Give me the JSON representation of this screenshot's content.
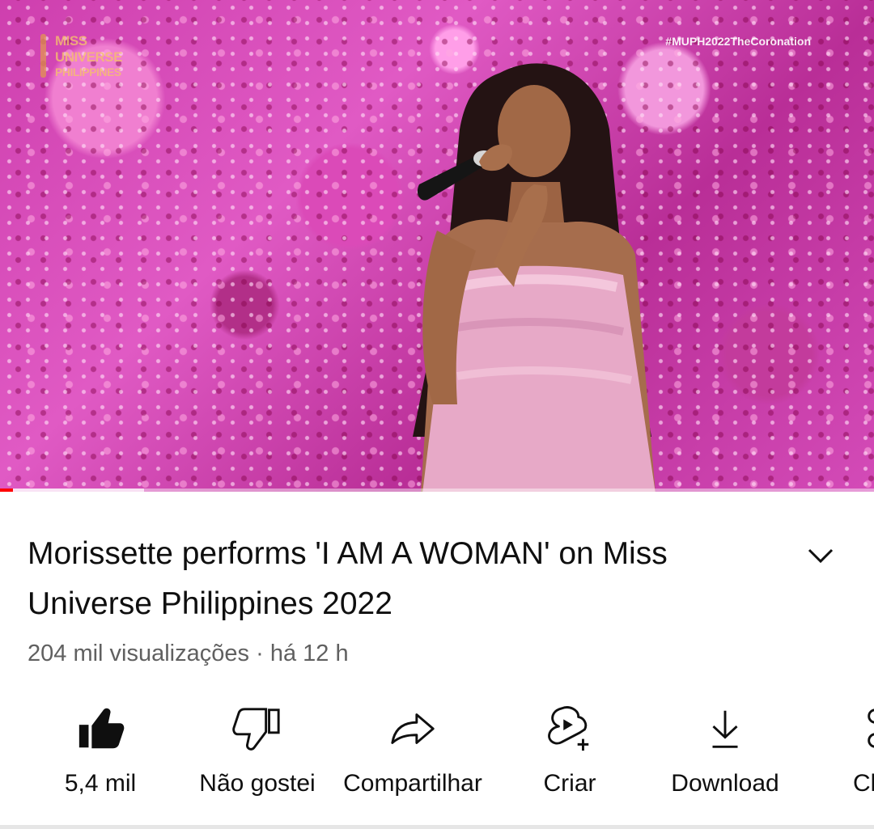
{
  "video": {
    "logo_text": "MISS UNIVERSE PHILIPPINES",
    "hashtag": "#MUPH2022TheCoronation",
    "progress_fraction": 0.015,
    "buffer_fraction": 0.165
  },
  "details": {
    "title": "Morissette performs 'I AM A WOMAN' on Miss Universe Philippines 2022",
    "views": "204 mil visualizações",
    "separator": "·",
    "age": "há 12 h"
  },
  "actions": [
    {
      "id": "like",
      "icon": "thumbs-up-filled-icon",
      "label": "5,4 mil"
    },
    {
      "id": "dislike",
      "icon": "thumbs-down-icon",
      "label": "Não gostei"
    },
    {
      "id": "share",
      "icon": "share-arrow-icon",
      "label": "Compartilhar"
    },
    {
      "id": "create",
      "icon": "create-shorts-icon",
      "label": "Criar"
    },
    {
      "id": "download",
      "icon": "download-icon",
      "label": "Download"
    },
    {
      "id": "clip",
      "icon": "clip-scissors-icon",
      "label": "Cl"
    }
  ],
  "colors": {
    "progress": "#ff0000",
    "text_primary": "#0f0f0f",
    "text_secondary": "#606060"
  }
}
